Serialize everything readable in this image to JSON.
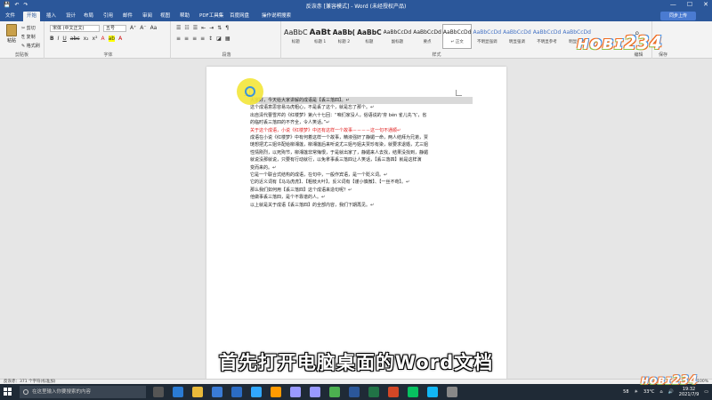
{
  "window": {
    "title": "反诙赤 [兼容模式] - Word (未经授权产品)",
    "controls": [
      "—",
      "☐",
      "✕"
    ]
  },
  "menu": {
    "tabs": [
      "文件",
      "开始",
      "插入",
      "设计",
      "布局",
      "引用",
      "邮件",
      "审阅",
      "视图",
      "帮助",
      "PDF工具集",
      "百度网盘",
      "操作说明搜索"
    ],
    "active_index": 1,
    "upload_label": "同步上传"
  },
  "ribbon": {
    "clipboard": {
      "paste": "粘贴",
      "cut": "✂ 剪切",
      "copy": "⎘ 复制",
      "format_painter": "✎ 格式刷",
      "label": "剪贴板"
    },
    "font": {
      "face": "宋体 (中文正文)",
      "size": "五号",
      "label": "字体"
    },
    "paragraph": {
      "label": "段落"
    },
    "styles": {
      "label": "样式",
      "items": [
        {
          "sample": "AaBbC",
          "name": "标题"
        },
        {
          "sample": "AaBt",
          "name": "标题 1"
        },
        {
          "sample": "AaBb(",
          "name": "标题 2"
        },
        {
          "sample": "AaBbC",
          "name": "标题"
        },
        {
          "sample": "AaBbCcDd",
          "name": "副标题"
        },
        {
          "sample": "AaBbCcDd",
          "name": "要点"
        },
        {
          "sample": "AaBbCcDd",
          "name": "↵ 正文"
        },
        {
          "sample": "AaBbCcDd",
          "name": "不明显强调"
        },
        {
          "sample": "AaBbCcDd",
          "name": "明显强调"
        },
        {
          "sample": "AaBbCcDd",
          "name": "不明显参考"
        },
        {
          "sample": "AaBbCcDd",
          "name": "明显参考"
        }
      ],
      "selected_index": 6
    },
    "editing": {
      "label": "编辑"
    },
    "save": {
      "label": "保存"
    }
  },
  "document": {
    "lines": [
      {
        "text": "大家好，今天给大家讲解的成语是【丢三落四】。↵",
        "style": "normal"
      },
      {
        "text": "这个成语意思容易马虎粗心，不是丢了这个，就是忘了那个。↵",
        "style": "normal"
      },
      {
        "text": "出自清代曹雪芹的《红楼梦》第六十七回：“咱们家没人，俗语说的‘夯 bèn 雀儿先飞’，省",
        "style": "normal"
      },
      {
        "text": "的临时丢三落四的不齐全，令人笑话。”↵",
        "style": "normal"
      },
      {
        "text": "关于这个成语，小说《红楼梦》中还有这样一个故事－－－－这一句不通顺↵",
        "style": "red"
      },
      {
        "text": "成语在小说《红楼梦》中有何着这样一个故事，精液强奸了静媚一命，两人结拜为兄弟，贾",
        "style": "normal"
      },
      {
        "text": "琏想把尤三姐许配给柳湘莲，柳湘莲后来听说尤三姐与姐夫贾珍有染，就要求退婚，尤三姐",
        "style": "normal"
      },
      {
        "text": "性情刚烈，以死殉节，柳湘莲非常悔恨，于是就出家了，静媚来人去找，结果没找到，静媚",
        "style": "normal"
      },
      {
        "text": "就说没那就说，只要有行动就行，以免拿事丢三落四让人笑话，【丢三落四】就是这样演",
        "style": "normal"
      },
      {
        "text": "变而来的。↵",
        "style": "normal"
      },
      {
        "text": "它是一个联合式结构的成语，在句中，一般作宾语，是一个贬义词。↵",
        "style": "normal"
      },
      {
        "text": "它的近义词有【马马虎虎】、【粗枝大叶】，反义词有【谨小慎微】、【一丝不苟】。↵",
        "style": "normal"
      },
      {
        "text": "那么我们如何用【丢三落四】这个成语来造句呢？↵",
        "style": "normal"
      },
      {
        "text": "他做事丢三落四，是个不靠谱的人。↵",
        "style": "normal"
      },
      {
        "text": "以上就是关于成语【丢三落四】的全部内容，我们下期再见。↵",
        "style": "normal"
      }
    ]
  },
  "subtitle": "首先打开电脑桌面的Word文档",
  "logo_text": "ʜᴏʙɪ234",
  "status": {
    "left": "反诙赤：371 个字符(标准加)",
    "zoom": "+ 100%"
  },
  "taskbar": {
    "search_placeholder": "在这里输入你要搜索的内容",
    "weather": "33°C",
    "weather_label": "58",
    "time": "19:32",
    "date": "2021/7/9"
  },
  "colors": {
    "word_blue": "#2b579a",
    "red_text": "#e02020",
    "highlight_yellow": "#f3e63a",
    "taskbar": "#1f2a36"
  }
}
